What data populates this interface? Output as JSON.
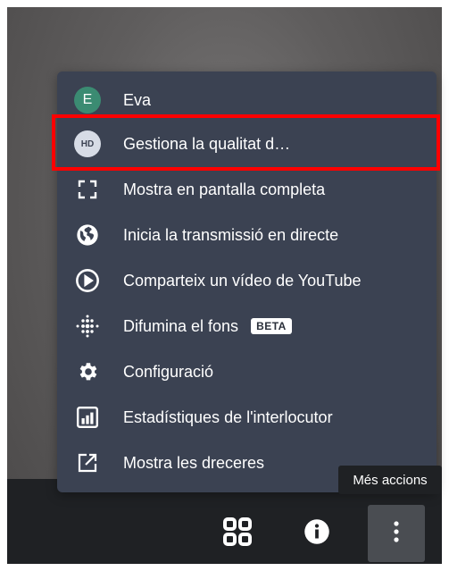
{
  "menu": {
    "items": [
      {
        "label": "Eva",
        "icon": "avatar-icon",
        "avatar_letter": "E"
      },
      {
        "label": "Gestiona la qualitat d…",
        "icon": "hd-quality-icon",
        "badge_text": "HD"
      },
      {
        "label": "Mostra en pantalla completa",
        "icon": "fullscreen-icon"
      },
      {
        "label": "Inicia la transmissió en directe",
        "icon": "globe-icon"
      },
      {
        "label": "Comparteix un vídeo de YouTube",
        "icon": "play-circle-icon"
      },
      {
        "label": "Difumina el fons",
        "icon": "blur-icon",
        "badge": "BETA"
      },
      {
        "label": "Configuració",
        "icon": "gear-icon"
      },
      {
        "label": "Estadístiques de l'interlocutor",
        "icon": "stats-icon"
      },
      {
        "label": "Mostra les dreceres",
        "icon": "external-link-icon"
      }
    ]
  },
  "tooltip": {
    "text": "Més accions"
  },
  "toolbar": {
    "buttons": [
      {
        "name": "tile-view-button",
        "icon": "grid-icon"
      },
      {
        "name": "info-button",
        "icon": "info-icon"
      },
      {
        "name": "more-actions-button",
        "icon": "more-vertical-icon"
      }
    ]
  },
  "colors": {
    "menu_bg": "#3b4252",
    "highlight": "#ff0000",
    "avatar": "#3b8b72"
  }
}
